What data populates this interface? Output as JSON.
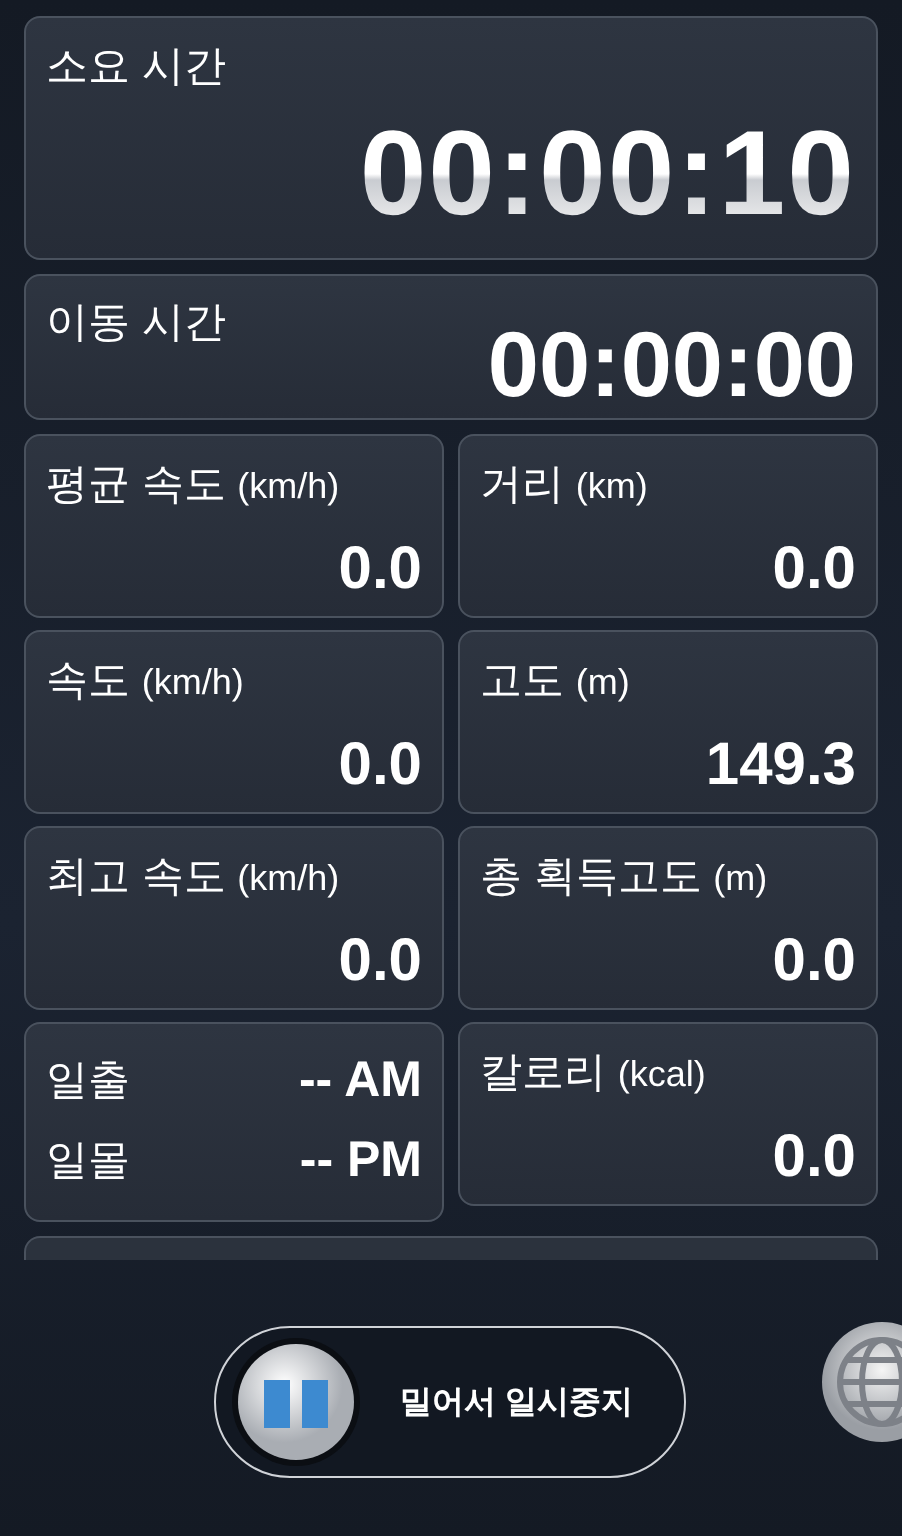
{
  "elapsed": {
    "label": "소요 시간",
    "value": "00:00:10"
  },
  "moving": {
    "label": "이동 시간",
    "value": "00:00:00"
  },
  "grid": [
    {
      "kind": "stat",
      "label": "평균 속도",
      "unit": "(km/h)",
      "value": "0.0"
    },
    {
      "kind": "stat",
      "label": "거리",
      "unit": "(km)",
      "value": "0.0"
    },
    {
      "kind": "stat",
      "label": "속도",
      "unit": "(km/h)",
      "value": "0.0"
    },
    {
      "kind": "stat",
      "label": "고도",
      "unit": "(m)",
      "value": "149.3"
    },
    {
      "kind": "stat",
      "label": "최고 속도",
      "unit": "(km/h)",
      "value": "0.0"
    },
    {
      "kind": "stat",
      "label": "총 획득고도",
      "unit": "(m)",
      "value": "0.0"
    },
    {
      "kind": "sun",
      "rows": [
        {
          "label": "일출",
          "value": "-- AM"
        },
        {
          "label": "일몰",
          "value": "-- PM"
        }
      ]
    },
    {
      "kind": "stat",
      "label": "칼로리",
      "unit": "(kcal)",
      "value": "0.0"
    }
  ],
  "slider": {
    "label": "밀어서 일시중지"
  }
}
